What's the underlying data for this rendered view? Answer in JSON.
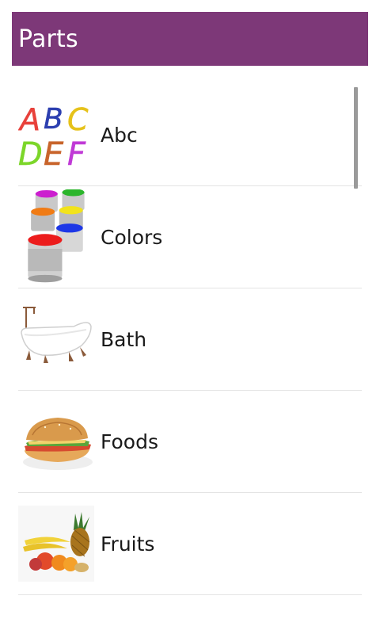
{
  "header": {
    "title": "Parts",
    "background_color": "#7d3878"
  },
  "list": {
    "items": [
      {
        "label": "Abc",
        "icon": "abc-letters-icon"
      },
      {
        "label": "Colors",
        "icon": "paint-cans-icon"
      },
      {
        "label": "Bath",
        "icon": "bathtub-icon"
      },
      {
        "label": "Foods",
        "icon": "sandwich-icon"
      },
      {
        "label": "Fruits",
        "icon": "fruits-icon"
      }
    ],
    "abc_icon_text": {
      "top": "ABC",
      "bottom": "DEF"
    }
  }
}
